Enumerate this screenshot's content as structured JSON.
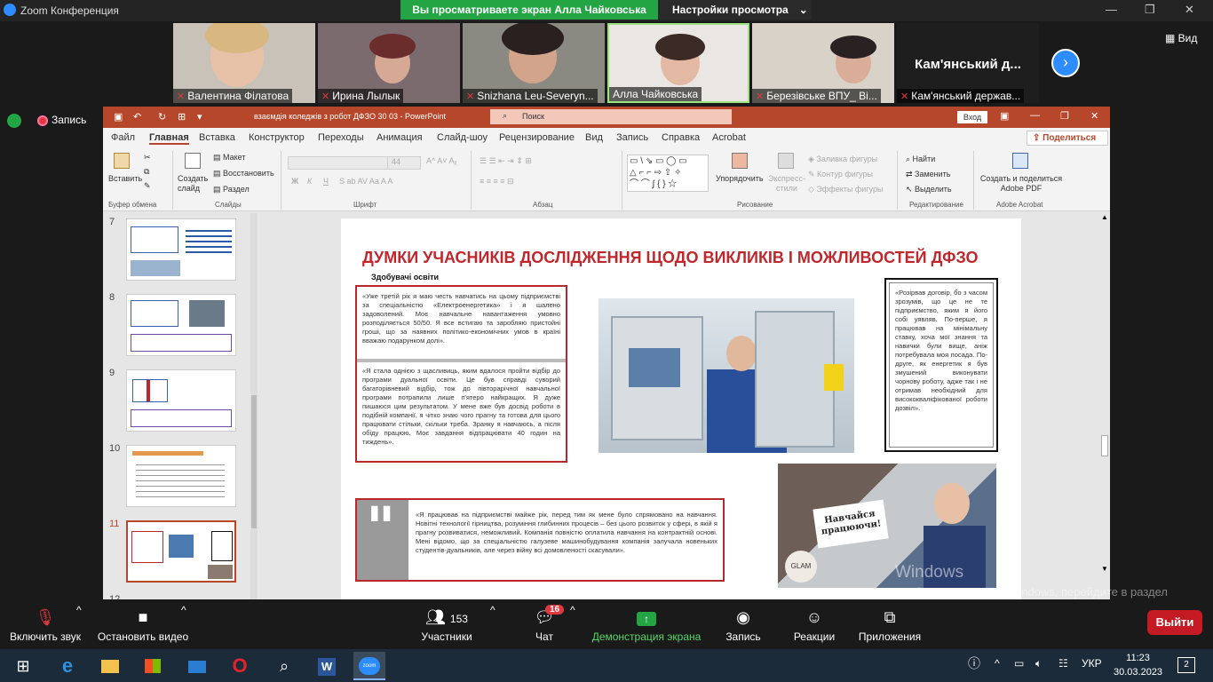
{
  "zoom": {
    "app_title": "Zoom Конференция",
    "banner_text": "Вы просматриваете экран Алла Чайковська",
    "view_options_label": "Настройки просмотра",
    "view_label": "Вид",
    "record_label": "Запись"
  },
  "participants": [
    {
      "name": "Валентина Філатова"
    },
    {
      "name": "Ирина Лылык"
    },
    {
      "name": "Snizhana Leu-Severyn..."
    },
    {
      "name": "Алла Чайковська"
    },
    {
      "name": "Березівське ВПУ_ Ві..."
    },
    {
      "name": "Кам'янський держав...",
      "display_name": "Кам'янський  д..."
    }
  ],
  "ppt": {
    "file_title": "взаємдія коледжів з робот ДФЗО 30 03  -  PowerPoint",
    "search_placeholder": "Поиск",
    "signin_label": "Вход",
    "share_label": "Поделиться",
    "menu": [
      "Файл",
      "Главная",
      "Вставка",
      "Конструктор",
      "Переходы",
      "Анимация",
      "Слайд-шоу",
      "Рецензирование",
      "Вид",
      "Запись",
      "Справка",
      "Acrobat"
    ],
    "ribbon": {
      "paste": "Вставить",
      "clipboard_group": "Буфер обмена",
      "new_slide": "Создать слайд",
      "layout": "Макет",
      "reset": "Восстановить",
      "section": "Раздел",
      "slides_group": "Слайды",
      "font_size": "44",
      "font_group": "Шрифт",
      "paragraph_group": "Абзац",
      "arrange": "Упорядочить",
      "quick_styles": "Экспресс-стили",
      "shape_fill": "Заливка фигуры",
      "shape_outline": "Контур фигуры",
      "shape_effects": "Эффекты фигуры",
      "drawing_group": "Рисование",
      "find": "Найти",
      "replace": "Заменить",
      "select": "Выделить",
      "editing_group": "Редактирование",
      "acrobat_create": "Создать и поделиться Adobe PDF",
      "acrobat_group": "Adobe Acrobat"
    },
    "slide_numbers": [
      "7",
      "8",
      "9",
      "10",
      "11",
      "12"
    ]
  },
  "slide": {
    "title": "ДУМКИ УЧАСНИКІВ ДОСЛІДЖЕННЯ ЩОДО ВИКЛИКІВ І МОЖЛИВОСТЕЙ ДФЗО",
    "subtitle": "Здобувачі освіти",
    "quote1": "«Уже третій рік я маю честь навчатись на цьому підприємстві за спеціальністю «Електроенергетика» і я шалено задоволений. Моє навчальне навантаження умовно розподіляється 50/50. Я все встигаю та заробляю пристойні гроші, що за наявних політико-економічних умов в країні вважаю подарунком долі».",
    "quote2": "«Я стала однією з щасливиць, яким вдалося пройти відбір до програми дуальної освіти. Це був справді суворий багаторівневий відбір, тож до півторарічної навчальної програми потрапили лише п'ятеро найкращих. Я дуже пишаюся цим результатом. У мене вже був досвід роботи в подібній компанії, я чітко знаю чого прагну та готова для цього працювати стільки, скільки треба. Зранку я навчаюсь, а після обіду працюю. Моє завдання відпрацювати 40 годин на тиждень».",
    "quote3": "«Розірвав договір, бо з часом зрозумів, що це не те підприємство, яким я його собі уявляв. По-перше, я працював на мінімальну ставку, хоча мої знання та навички були вище, аніж потребувала моя посада. По-друге, як енергетик я був змушений виконувати чорнову роботу, адже так і не отримав необхідний для висококваліфікованої роботи дозвіл».",
    "quote4": "«Я працював на підприємстві майже рік, перед тим як мене було спрямовано на навчання. Новітні технології гірництва, розуміння глибинних процесів – без цього розвиток у сфері, в якій я прагну розвиватися, неможливий. Компанія повністю оплатила навчання на контрактній основі. Мені відомо, що за спеціальністю галузеве машинобудування компанія залучала новеньких студентів-дуальників, але через війну всі домовленості скасували».",
    "photo2_badge": "Навчайся працюючи!",
    "photo2_sign": "GLAM"
  },
  "windows_watermark": {
    "line1": "Windows",
    "line2": "Чтобы активировать Windows, перейдите в раздел \"Параметры\"."
  },
  "controls": {
    "mute": "Включить звук",
    "video": "Остановить видео",
    "participants": "Участники",
    "participants_count": "153",
    "chat": "Чат",
    "chat_badge": "16",
    "share": "Демонстрация экрана",
    "record": "Запись",
    "reactions": "Реакции",
    "apps": "Приложения",
    "leave": "Выйти"
  },
  "taskbar": {
    "lang": "УКР",
    "time": "11:23",
    "date": "30.03.2023",
    "notifications": "2"
  }
}
